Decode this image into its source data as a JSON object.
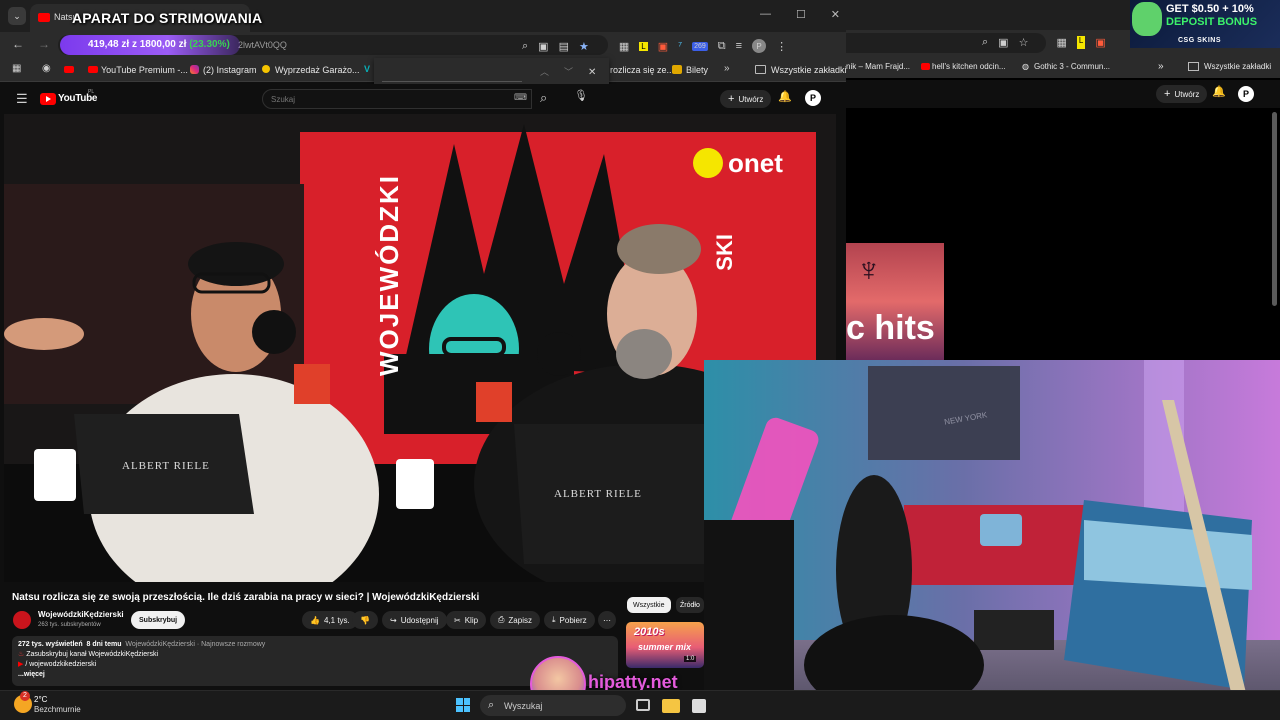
{
  "overlay": {
    "stream_title": "APARAT DO STRIMOWANIA",
    "stats_amount": "419,48 zł",
    "stats_separator": "z",
    "stats_goal": "1800,00 zł",
    "stats_percent": "(23.30%)",
    "url_fragment": "2lwtAVt0QQ",
    "watermark": "hipatty.net"
  },
  "ad_banner": {
    "line1": "GET $0.50 + 10%",
    "line2": "DEPOSIT BONUS",
    "brand": "CSG SKINS"
  },
  "browser": {
    "tab_title": "Natsu",
    "bookmarks": [
      "YouTube Premium -...",
      "(2) Instagram",
      "Wyprzedaż Garażo...",
      "rozlicza się ze...",
      "Bilety"
    ],
    "bookmarks_all": "Wszystkie zakładki",
    "extension_badge": "269"
  },
  "youtube": {
    "logo_text": "YouTube",
    "logo_region": "PL",
    "search_placeholder": "Szukaj",
    "create_label": "Utwórz",
    "avatar_letter": "P",
    "video_title": "Natsu rozlicza się ze swoją przeszłością. Ile dziś zarabia na pracy w sieci? | WojewódzkiKędzierski",
    "channel_name": "WojewódzkiKędzierski",
    "subscriber_count": "263 tys. subskrybentów",
    "subscribe_label": "Subskrybuj",
    "like_count": "4,1 tys.",
    "share_label": "Udostępnij",
    "clip_label": "Klip",
    "save_label": "Zapisz",
    "download_label": "Pobierz",
    "description": {
      "views": "272 tys. wyświetleń",
      "date": "8 dni temu",
      "tags": "WojewódzkiKędzierski · Najnowsze rozmowy",
      "line1": "Zasubskrybuj kanał WojewódzkiKędzierski",
      "line2": "/ wojewodzkikedzierski",
      "more": "...więcej"
    },
    "chips": [
      "Wszystkie",
      "Źródło"
    ],
    "thumb_text_1": "2010s",
    "thumb_text_2": "summer mix",
    "thumb_duration": "1:0"
  },
  "video_scene": {
    "brand_text": "onet",
    "banner_text": "WOJEWÓDZKI",
    "laptop_brand": "ALBERT RIELE",
    "right_banner": "SKI"
  },
  "second_window": {
    "bookmarks": [
      "nik – Mam Frajd...",
      "hell's kitchen odcin...",
      "Gothic 3 - Commun..."
    ],
    "bookmarks_all": "Wszystkie zakładki",
    "create_label": "Utwórz",
    "avatar_letter": "P",
    "thumb_text": "c hits"
  },
  "webcam": {
    "wall_text": "NEW YORK"
  },
  "taskbar": {
    "temperature": "2°C",
    "weather": "Bezchmurnie",
    "search_label": "Wyszukaj",
    "weather_badge": "2"
  },
  "colors": {
    "accent_purple": "#7c3aed",
    "youtube_red": "#ff0000",
    "onet_yellow": "#f5e600",
    "percent_green": "#39d353",
    "bonus_green": "#3cf26b"
  }
}
